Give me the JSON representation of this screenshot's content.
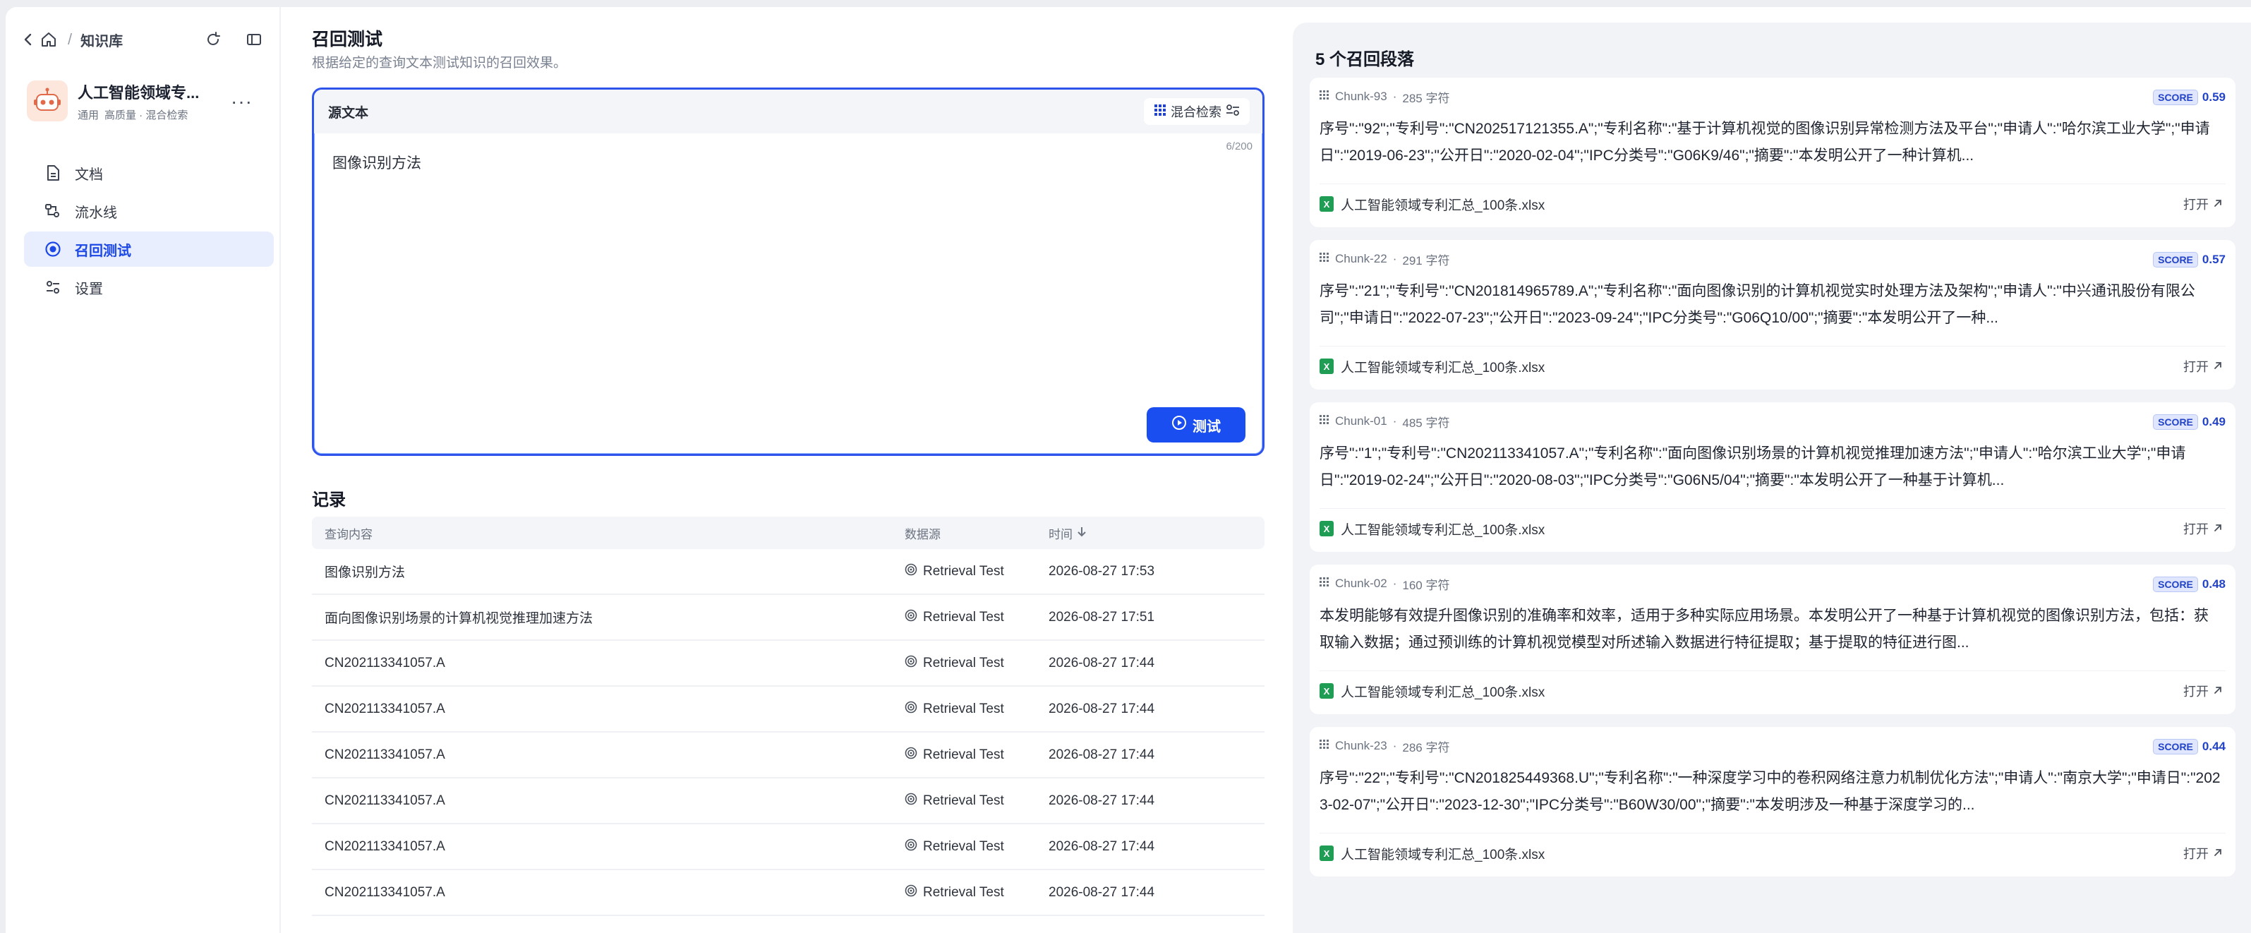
{
  "sidebar": {
    "breadcrumb": "知识库",
    "kb_name": "人工智能领域专...",
    "kb_tags": [
      "通用",
      "高质量 · 混合检索"
    ],
    "more_label": "···",
    "items": [
      {
        "label": "文档",
        "icon": "document-icon"
      },
      {
        "label": "流水线",
        "icon": "pipeline-icon"
      },
      {
        "label": "召回测试",
        "icon": "target-icon"
      },
      {
        "label": "设置",
        "icon": "settings-icon"
      }
    ]
  },
  "main": {
    "title": "召回测试",
    "subtitle": "根据给定的查询文本测试知识的召回效果。",
    "source_label": "源文本",
    "mode_label": "混合检索",
    "char_count": "6/200",
    "query_text": "图像识别方法",
    "test_button": "测试",
    "records_title": "记录",
    "columns": {
      "query": "查询内容",
      "source": "数据源",
      "time": "时间"
    },
    "rows": [
      {
        "query": "图像识别方法",
        "source": "Retrieval Test",
        "time": "2026-08-27 17:53"
      },
      {
        "query": "面向图像识别场景的计算机视觉推理加速方法",
        "source": "Retrieval Test",
        "time": "2026-08-27 17:51"
      },
      {
        "query": "CN202113341057.A",
        "source": "Retrieval Test",
        "time": "2026-08-27 17:44"
      },
      {
        "query": "CN202113341057.A",
        "source": "Retrieval Test",
        "time": "2026-08-27 17:44"
      },
      {
        "query": "CN202113341057.A",
        "source": "Retrieval Test",
        "time": "2026-08-27 17:44"
      },
      {
        "query": "CN202113341057.A",
        "source": "Retrieval Test",
        "time": "2026-08-27 17:44"
      },
      {
        "query": "CN202113341057.A",
        "source": "Retrieval Test",
        "time": "2026-08-27 17:44"
      },
      {
        "query": "CN202113341057.A",
        "source": "Retrieval Test",
        "time": "2026-08-27 17:44"
      }
    ]
  },
  "results": {
    "title": "5 个召回段落",
    "score_tag": "SCORE",
    "open_label": "打开",
    "chunks": [
      {
        "id": "Chunk-93",
        "chars": "285 字符",
        "score": "0.59",
        "text": "序号\":\"92\";\"专利号\":\"CN202517121355.A\";\"专利名称\":\"基于计算机视觉的图像识别异常检测方法及平台\";\"申请人\":\"哈尔滨工业大学\";\"申请日\":\"2019-06-23\";\"公开日\":\"2020-02-04\";\"IPC分类号\":\"G06K9/46\";\"摘要\":\"本发明公开了一种计算机...",
        "file": "人工智能领域专利汇总_100条.xlsx"
      },
      {
        "id": "Chunk-22",
        "chars": "291 字符",
        "score": "0.57",
        "text": "序号\":\"21\";\"专利号\":\"CN201814965789.A\";\"专利名称\":\"面向图像识别的计算机视觉实时处理方法及架构\";\"申请人\":\"中兴通讯股份有限公司\";\"申请日\":\"2022-07-23\";\"公开日\":\"2023-09-24\";\"IPC分类号\":\"G06Q10/00\";\"摘要\":\"本发明公开了一种...",
        "file": "人工智能领域专利汇总_100条.xlsx"
      },
      {
        "id": "Chunk-01",
        "chars": "485 字符",
        "score": "0.49",
        "text": "序号\":\"1\";\"专利号\":\"CN202113341057.A\";\"专利名称\":\"面向图像识别场景的计算机视觉推理加速方法\";\"申请人\":\"哈尔滨工业大学\";\"申请日\":\"2019-02-24\";\"公开日\":\"2020-08-03\";\"IPC分类号\":\"G06N5/04\";\"摘要\":\"本发明公开了一种基于计算机...",
        "file": "人工智能领域专利汇总_100条.xlsx"
      },
      {
        "id": "Chunk-02",
        "chars": "160 字符",
        "score": "0.48",
        "text": "本发明能够有效提升图像识别的准确率和效率，适用于多种实际应用场景。本发明公开了一种基于计算机视觉的图像识别方法，包括：获取输入数据；通过预训练的计算机视觉模型对所述输入数据进行特征提取；基于提取的特征进行图...",
        "file": "人工智能领域专利汇总_100条.xlsx"
      },
      {
        "id": "Chunk-23",
        "chars": "286 字符",
        "score": "0.44",
        "text": "序号\":\"22\";\"专利号\":\"CN201825449368.U\";\"专利名称\":\"一种深度学习中的卷积网络注意力机制优化方法\";\"申请人\":\"南京大学\";\"申请日\":\"2023-02-07\";\"公开日\":\"2023-12-30\";\"IPC分类号\":\"B60W30/00\";\"摘要\":\"本发明涉及一种基于深度学习的...",
        "file": "人工智能领域专利汇总_100条.xlsx"
      }
    ]
  },
  "colors": {
    "accent": "#1b4ef0",
    "active_bg": "#e8eefd",
    "panel_bg": "#f1f3f6"
  }
}
